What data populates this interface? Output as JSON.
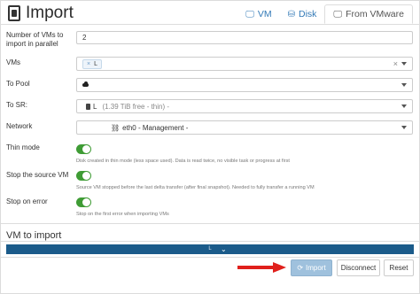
{
  "header": {
    "title": "Import",
    "tabs": [
      {
        "label": "VM",
        "icon": "monitor-icon"
      },
      {
        "label": "Disk",
        "icon": "disk-icon"
      },
      {
        "label": "From VMware",
        "icon": "monitor-icon",
        "active": true
      }
    ]
  },
  "form": {
    "parallel": {
      "label": "Number of VMs to import in parallel",
      "value": "2"
    },
    "vms": {
      "label": "VMs",
      "tag": "L",
      "tag_remove": "×",
      "clear": "×"
    },
    "pool": {
      "label": "To Pool",
      "value": ""
    },
    "sr": {
      "label": "To SR:",
      "name": "L",
      "detail": "(1.39 TiB free - thin) -"
    },
    "network": {
      "label": "Network",
      "value": "eth0 - Management -"
    },
    "thin": {
      "label": "Thin mode",
      "enabled": true,
      "help": "Disk created in thin mode (less space used). Data is read twice, no visible task or progress at first"
    },
    "stop_source": {
      "label": "Stop the source VM",
      "enabled": true,
      "help": "Source VM stopped before the last delta transfer (after final snapshot). Needed to fully transfer a running VM"
    },
    "stop_error": {
      "label": "Stop on error",
      "enabled": true,
      "help": "Stop on the first error when importing VMs"
    }
  },
  "vm_to_import": {
    "title": "VM to import",
    "bar_label": "L"
  },
  "actions": {
    "import_label": "Import",
    "disconnect_label": "Disconnect",
    "reset_label": "Reset"
  },
  "colors": {
    "link": "#337ab7",
    "toggle_on": "#3f9c35",
    "vm_bar": "#1b5b8a",
    "import_button": "#9fc1dd",
    "arrow": "#e0201c"
  }
}
